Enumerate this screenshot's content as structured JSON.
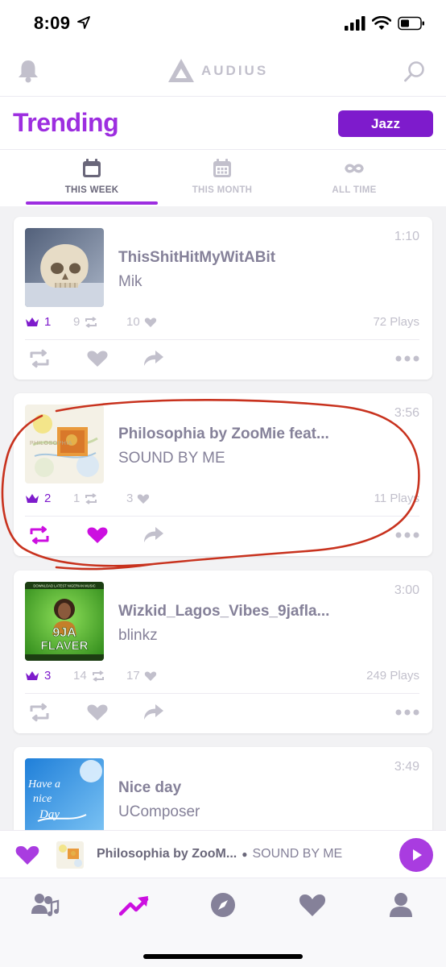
{
  "status_bar": {
    "time": "8:09"
  },
  "header": {
    "logo_text": "AUDIUS"
  },
  "trending": {
    "title": "Trending",
    "genre": "Jazz"
  },
  "tabs": [
    {
      "label": "THIS WEEK",
      "icon": "calendar-week-icon",
      "active": true
    },
    {
      "label": "THIS MONTH",
      "icon": "calendar-month-icon",
      "active": false
    },
    {
      "label": "ALL TIME",
      "icon": "infinity-icon",
      "active": false
    }
  ],
  "tracks": [
    {
      "rank": "1",
      "title": "ThisShitHitMyWitABit",
      "artist": "Mik",
      "duration": "1:10",
      "reposts": "9",
      "favorites": "10",
      "plays": "72 Plays",
      "reposted": false,
      "favorited": false
    },
    {
      "rank": "2",
      "title": "Philosophia by ZooMie feat...",
      "artist": "SOUND BY ME",
      "duration": "3:56",
      "reposts": "1",
      "favorites": "3",
      "plays": "11 Plays",
      "reposted": true,
      "favorited": true
    },
    {
      "rank": "3",
      "title": "Wizkid_Lagos_Vibes_9jafla...",
      "artist": "blinkz",
      "duration": "3:00",
      "reposts": "14",
      "favorites": "17",
      "plays": "249 Plays",
      "reposted": false,
      "favorited": false
    },
    {
      "rank": "",
      "title": "Nice day",
      "artist": "UComposer",
      "duration": "3:49",
      "reposts": "",
      "favorites": "",
      "plays": "",
      "reposted": false,
      "favorited": false
    }
  ],
  "artwork_text": {
    "track2": "PHILOSOPHIA",
    "track3_top": "DOWNLOAD LATEST NIGERIAN MUSIC",
    "track3_line1": "9JA",
    "track3_line2": "FLAVER",
    "track4_line1": "Have a",
    "track4_line2": "nice",
    "track4_line3": "Day"
  },
  "now_playing": {
    "title": "Philosophia by ZooM...",
    "artist": "SOUND BY ME",
    "favorited": true
  },
  "bottom_nav": [
    {
      "label": "feed",
      "icon": "feed-icon",
      "active": false
    },
    {
      "label": "trending",
      "icon": "trending-icon",
      "active": true
    },
    {
      "label": "explore",
      "icon": "compass-icon",
      "active": false
    },
    {
      "label": "favorites",
      "icon": "heart-icon",
      "active": false
    },
    {
      "label": "profile",
      "icon": "profile-icon",
      "active": false
    }
  ],
  "colors": {
    "accent": "#7e1bcc",
    "trending_title": "#9d2ee0",
    "active_pink": "#cc0fe0",
    "annotation_red": "#c8321e",
    "muted": "#c2c0cc",
    "text": "#858199"
  }
}
